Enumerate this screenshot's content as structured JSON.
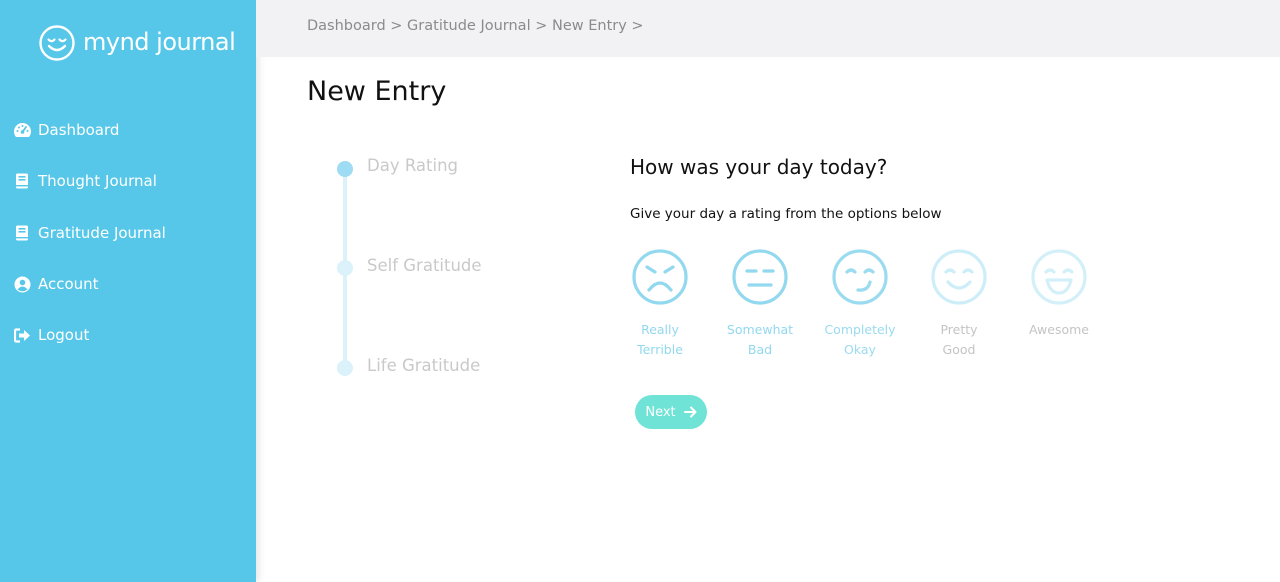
{
  "brand": {
    "name": "mynd journal",
    "icon": "smiley-logo-icon"
  },
  "sidebar": {
    "items": [
      {
        "label": "Dashboard",
        "icon": "dashboard-gauge-icon"
      },
      {
        "label": "Thought Journal",
        "icon": "book-icon"
      },
      {
        "label": "Gratitude Journal",
        "icon": "book-icon"
      },
      {
        "label": "Account",
        "icon": "user-circle-icon"
      },
      {
        "label": "Logout",
        "icon": "sign-out-icon"
      }
    ]
  },
  "breadcrumb": {
    "items": [
      "Dashboard",
      "Gratitude Journal",
      "New Entry"
    ],
    "separator": ">"
  },
  "page": {
    "title": "New Entry"
  },
  "stepper": {
    "steps": [
      {
        "label": "Day Rating",
        "active": true
      },
      {
        "label": "Self Gratitude",
        "active": false
      },
      {
        "label": "Life Gratitude",
        "active": false
      }
    ]
  },
  "question": {
    "title": "How was your day today?",
    "subtitle": "Give your day a rating from the options below"
  },
  "ratings": [
    {
      "line1": "Really",
      "line2": "Terrible",
      "icon": "very-sad-face-icon"
    },
    {
      "line1": "Somewhat",
      "line2": "Bad",
      "icon": "meh-face-icon"
    },
    {
      "line1": "Completely",
      "line2": "Okay",
      "icon": "smirk-face-icon"
    },
    {
      "line1": "Pretty",
      "line2": "Good",
      "icon": "smile-face-icon"
    },
    {
      "line1": "Awesome",
      "line2": "",
      "icon": "grin-face-icon"
    }
  ],
  "next_button": {
    "label": "Next",
    "icon": "arrow-right-icon"
  },
  "colors": {
    "sidebar": "#56c7e8",
    "accent_teal": "#6fe3d6",
    "step_active": "#9ddcf2",
    "step_inactive": "#dbf2fa"
  }
}
